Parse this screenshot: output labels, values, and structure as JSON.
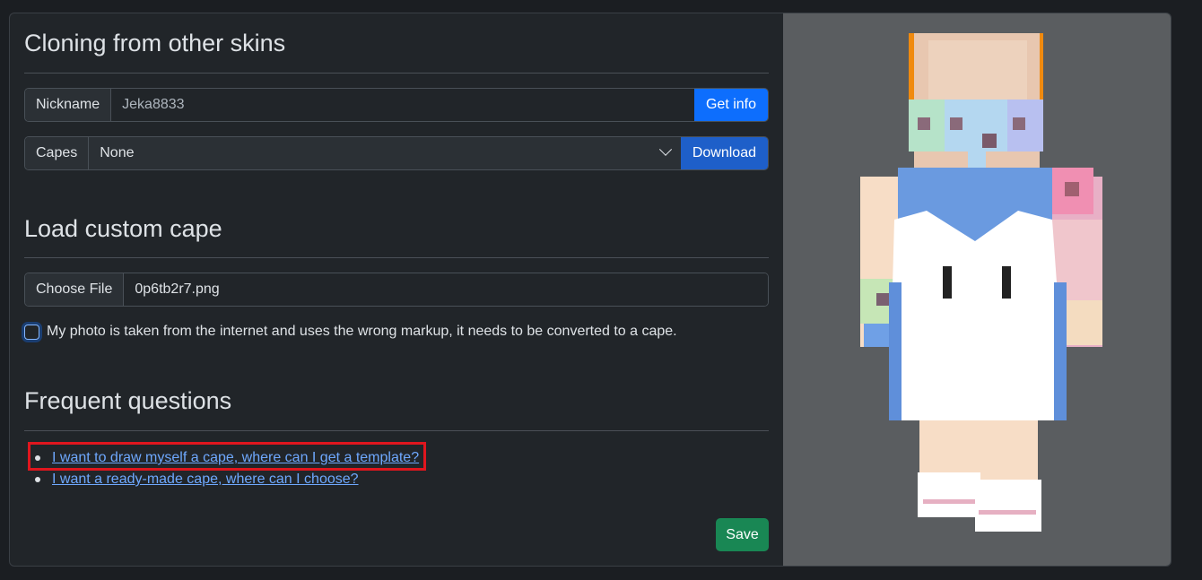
{
  "clone_section": {
    "title": "Cloning from other skins",
    "nickname_label": "Nickname",
    "nickname_value": "Jeka8833",
    "get_info_label": "Get info",
    "capes_label": "Capes",
    "capes_selected": "None",
    "download_label": "Download"
  },
  "custom_cape_section": {
    "title": "Load custom cape",
    "choose_file_label": "Choose File",
    "file_name": "0p6tb2r7.png",
    "convert_checkbox_label": "My photo is taken from the internet and uses the wrong markup, it needs to be converted to a cape."
  },
  "faq_section": {
    "title": "Frequent questions",
    "items": [
      {
        "label": "I want to draw myself a cape, where can I get a template?"
      },
      {
        "label": "I want a ready-made cape, where can I choose?"
      }
    ]
  },
  "save_label": "Save",
  "colors": {
    "primary": "#0d6efd",
    "success": "#198754",
    "link": "#6ea8fe",
    "highlight": "#e0161e"
  }
}
